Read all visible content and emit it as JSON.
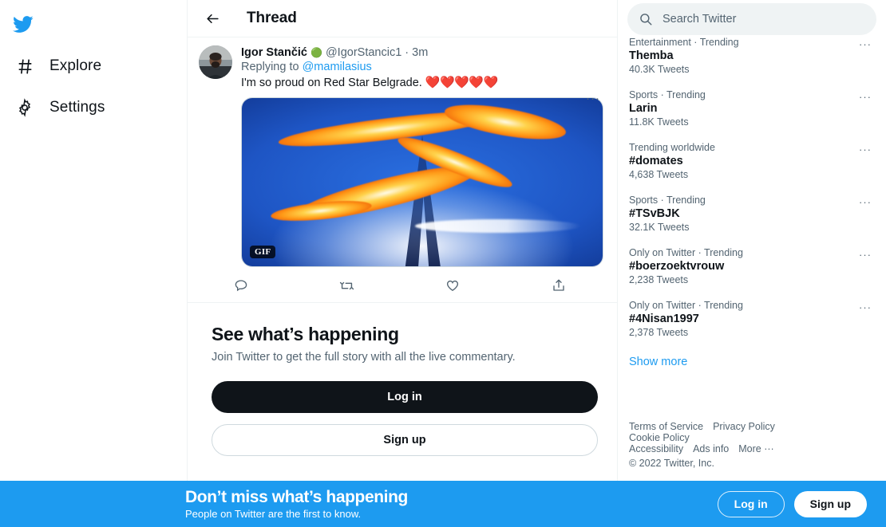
{
  "left_sidebar": {
    "logo": "twitter-bird",
    "items": [
      {
        "icon": "hashtag-icon",
        "label": "Explore"
      },
      {
        "icon": "gear-icon",
        "label": "Settings"
      }
    ]
  },
  "main": {
    "header": {
      "back": "back-arrow",
      "title": "Thread"
    },
    "tweet": {
      "author_name": "Igor Stančić",
      "author_badge": "🟢",
      "handle": "@IgorStancic1",
      "dot": "·",
      "time": "3m",
      "more": "···",
      "replying_label": "Replying to",
      "replying_to": "@mamilasius",
      "text": "I'm so proud on Red Star Belgrade.",
      "hearts": "❤️❤️❤️❤️❤️",
      "media": {
        "type": "gif",
        "badge": "GIF"
      },
      "actions": [
        {
          "name": "reply-icon"
        },
        {
          "name": "retweet-icon"
        },
        {
          "name": "like-icon"
        },
        {
          "name": "share-icon"
        }
      ]
    },
    "signup_card": {
      "title": "See what’s happening",
      "subtitle": "Join Twitter to get the full story with all the live commentary.",
      "login_label": "Log in",
      "signup_label": "Sign up"
    }
  },
  "right_sidebar": {
    "search": {
      "placeholder": "Search Twitter",
      "value": "",
      "icon": "search-icon"
    },
    "trends": [
      {
        "category": "Entertainment · Trending",
        "name": "Themba",
        "count": "40.3K Tweets",
        "more": "···"
      },
      {
        "category": "Sports · Trending",
        "name": "Larin",
        "count": "11.8K Tweets",
        "more": "···"
      },
      {
        "category": "Trending worldwide",
        "name": "#domates",
        "count": "4,638 Tweets",
        "more": "···"
      },
      {
        "category": "Sports · Trending",
        "name": "#TSvBJK",
        "count": "32.1K Tweets",
        "more": "···"
      },
      {
        "category": "Only on Twitter · Trending",
        "name": "#boerzoektvrouw",
        "count": "2,238 Tweets",
        "more": "···"
      },
      {
        "category": "Only on Twitter · Trending",
        "name": "#4Nisan1997",
        "count": "2,378 Tweets",
        "more": "···"
      }
    ],
    "show_more": "Show more",
    "footer": {
      "links_row1": [
        "Terms of Service",
        "Privacy Policy",
        "Cookie Policy"
      ],
      "links_row2": [
        "Accessibility",
        "Ads info",
        "More ···"
      ],
      "copyright": "© 2022 Twitter, Inc."
    }
  },
  "bottom_banner": {
    "title": "Don’t miss what’s happening",
    "subtitle": "People on Twitter are the first to know.",
    "login_label": "Log in",
    "signup_label": "Sign up",
    "background_color": "#1d9bf0"
  },
  "colors": {
    "twitter_blue": "#1d9bf0",
    "text_primary": "#0f1419",
    "text_secondary": "#536471",
    "border": "#eff3f4",
    "heart_red": "#e0245e"
  }
}
